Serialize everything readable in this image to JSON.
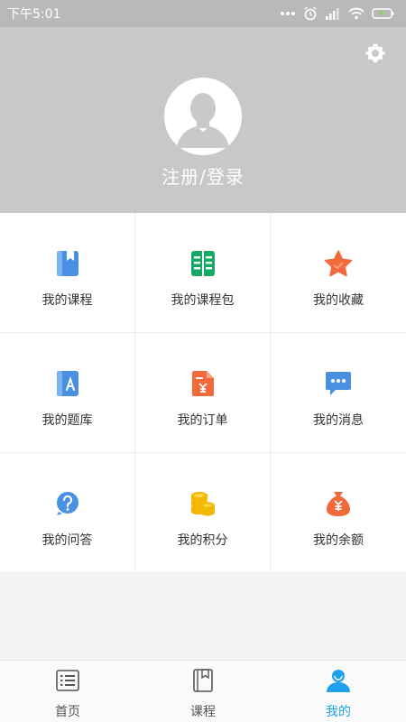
{
  "status_bar": {
    "time": "下午5:01"
  },
  "header": {
    "login_label": "注册/登录"
  },
  "grid": {
    "items": [
      {
        "label": "我的课程",
        "icon": "book-bookmark-icon"
      },
      {
        "label": "我的课程包",
        "icon": "open-book-icon"
      },
      {
        "label": "我的收藏",
        "icon": "star-icon"
      },
      {
        "label": "我的题库",
        "icon": "question-bank-icon"
      },
      {
        "label": "我的订单",
        "icon": "order-icon"
      },
      {
        "label": "我的消息",
        "icon": "message-icon"
      },
      {
        "label": "我的问答",
        "icon": "question-icon"
      },
      {
        "label": "我的积分",
        "icon": "coins-icon"
      },
      {
        "label": "我的余额",
        "icon": "money-bag-icon"
      }
    ]
  },
  "bottom_nav": {
    "items": [
      {
        "label": "首页",
        "icon": "home-list-icon"
      },
      {
        "label": "课程",
        "icon": "course-book-icon"
      },
      {
        "label": "我的",
        "icon": "profile-icon",
        "active": true
      }
    ]
  },
  "colors": {
    "accent": "#1ea0ea",
    "header_bg": "#c8c7ca",
    "status_bg": "#b9b8bb"
  }
}
